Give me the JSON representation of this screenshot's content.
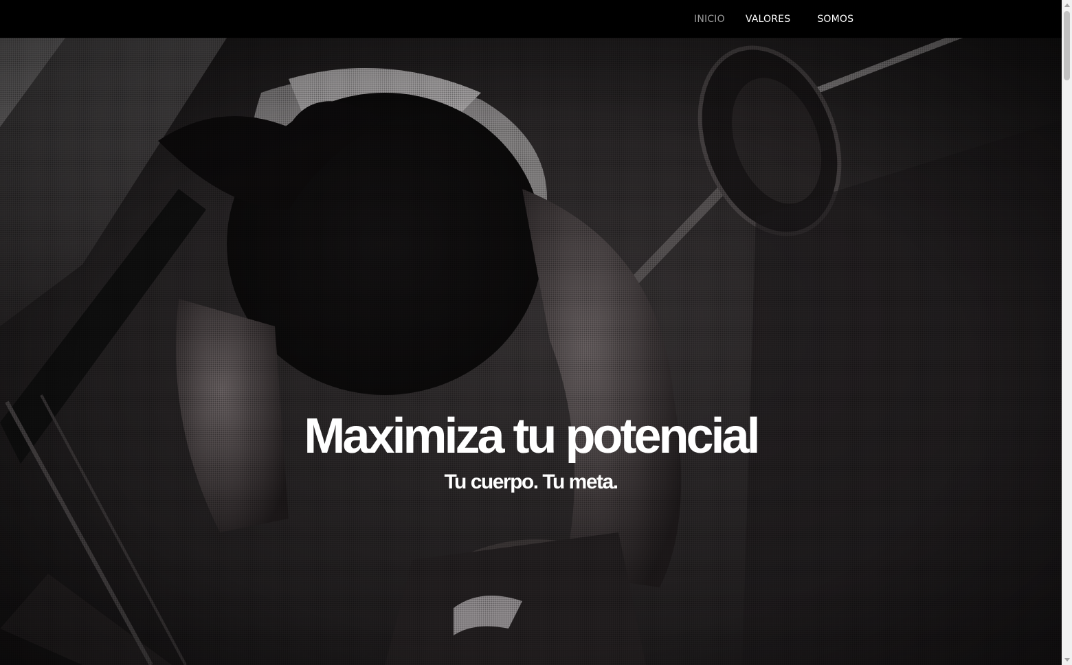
{
  "nav": {
    "items": [
      {
        "label": "INICIO",
        "active": true
      },
      {
        "label": "VALORES",
        "active": false
      },
      {
        "label": "SOMOS",
        "active": false
      }
    ]
  },
  "hero": {
    "title": "Maximiza tu potencial",
    "subtitle": "Tu cuerpo. Tu meta.",
    "background_image": "grayscale-gym-photo-woman-bent-over-barbell"
  },
  "colors": {
    "navbar_bg": "#000000",
    "nav_text": "#ffffff",
    "nav_active_text": "#9a9a9a",
    "hero_text": "#ffffff"
  }
}
